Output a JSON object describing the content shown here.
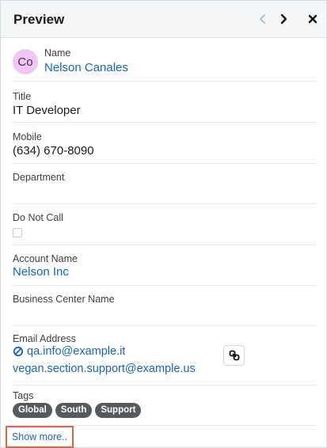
{
  "header": {
    "title": "Preview"
  },
  "record": {
    "avatar_initials": "Co",
    "name_label": "Name",
    "name_value": "Nelson Canales"
  },
  "fields": {
    "title_label": "Title",
    "title_value": "IT Developer",
    "mobile_label": "Mobile",
    "mobile_value": "(634) 670-8090",
    "department_label": "Department",
    "do_not_call_label": "Do Not Call",
    "account_name_label": "Account Name",
    "account_name_value": "Nelson Inc",
    "business_center_label": "Business Center Name",
    "email_label": "Email Address",
    "email_primary": "qa.info@example.it",
    "email_secondary": "vegan.section.support@example.us",
    "tags_label": "Tags",
    "tags": [
      "Global",
      "South",
      "Support"
    ]
  },
  "footer": {
    "show_more_label": "Show more.."
  },
  "colors": {
    "link": "#1565c0",
    "avatar_bg": "#f1c6f5",
    "tag_bg": "#555a5f",
    "highlight_border": "#d9664a"
  },
  "icons": {
    "prev": "chevron-left-icon",
    "next": "chevron-right-icon",
    "close": "close-icon",
    "opt_out": "opt-out-icon",
    "copy": "link-icon"
  }
}
